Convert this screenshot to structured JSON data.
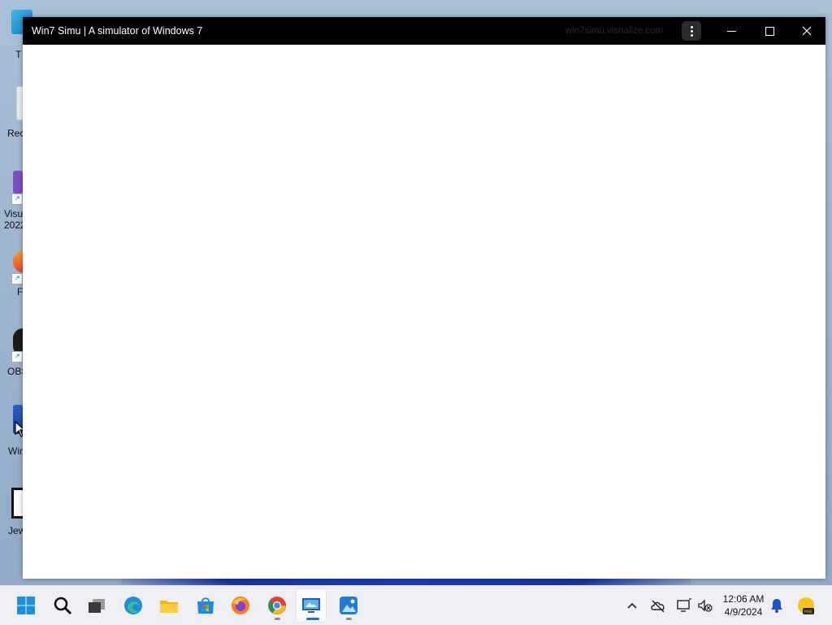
{
  "window": {
    "title": "Win7 Simu | A simulator of Windows 7",
    "url": "win7simu.visnalize.com"
  },
  "desktop": {
    "icons": [
      {
        "label": "T"
      },
      {
        "label": "Rec"
      },
      {
        "label": "Visu"
      },
      {
        "label": "2022"
      },
      {
        "label": "F"
      },
      {
        "label": "OBS"
      },
      {
        "label": "Win"
      },
      {
        "label": "Jew"
      }
    ]
  },
  "taskbar": {
    "apps": [
      "start-icon",
      "search-icon",
      "task-view-icon",
      "edge-icon",
      "file-explorer-icon",
      "store-icon",
      "firefox-icon",
      "chrome-icon",
      "remote-desktop-icon",
      "photos-icon"
    ]
  },
  "clock": {
    "time": "12:06 AM",
    "date": "4/9/2024"
  },
  "colors": {
    "accent": "#1f6fd6",
    "titlebar": "#000000",
    "taskbar": "#eef0f4"
  }
}
